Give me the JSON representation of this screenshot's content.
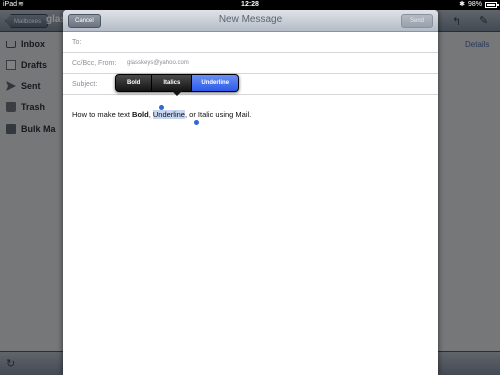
{
  "status_bar": {
    "device": "iPad",
    "time": "12:28",
    "battery": "98%"
  },
  "background": {
    "mailboxes_button": "Mailboxes",
    "title_partial": "glas",
    "details_link": "Details",
    "sidebar": {
      "items": [
        {
          "label": "Inbox",
          "icon": "inbox-icon"
        },
        {
          "label": "Drafts",
          "icon": "drafts-icon"
        },
        {
          "label": "Sent",
          "icon": "sent-icon"
        },
        {
          "label": "Trash",
          "icon": "trash-icon"
        },
        {
          "label": "Bulk Ma",
          "icon": "folder-icon"
        }
      ]
    }
  },
  "compose": {
    "cancel_label": "Cancel",
    "title": "New Message",
    "send_label": "Send",
    "to_label": "To:",
    "ccbcc_label": "Cc/Bcc, From:",
    "from_value": "glasskeys@yahoo.com",
    "subject_label": "Subject:",
    "format_menu": {
      "bold": "Bold",
      "italics": "Italics",
      "underline": "Underline"
    },
    "body": {
      "part1": "How to make text ",
      "bold": "Bold",
      "comma": ", ",
      "selected": "Underline",
      "part2": ", or Italic using Mail."
    }
  }
}
